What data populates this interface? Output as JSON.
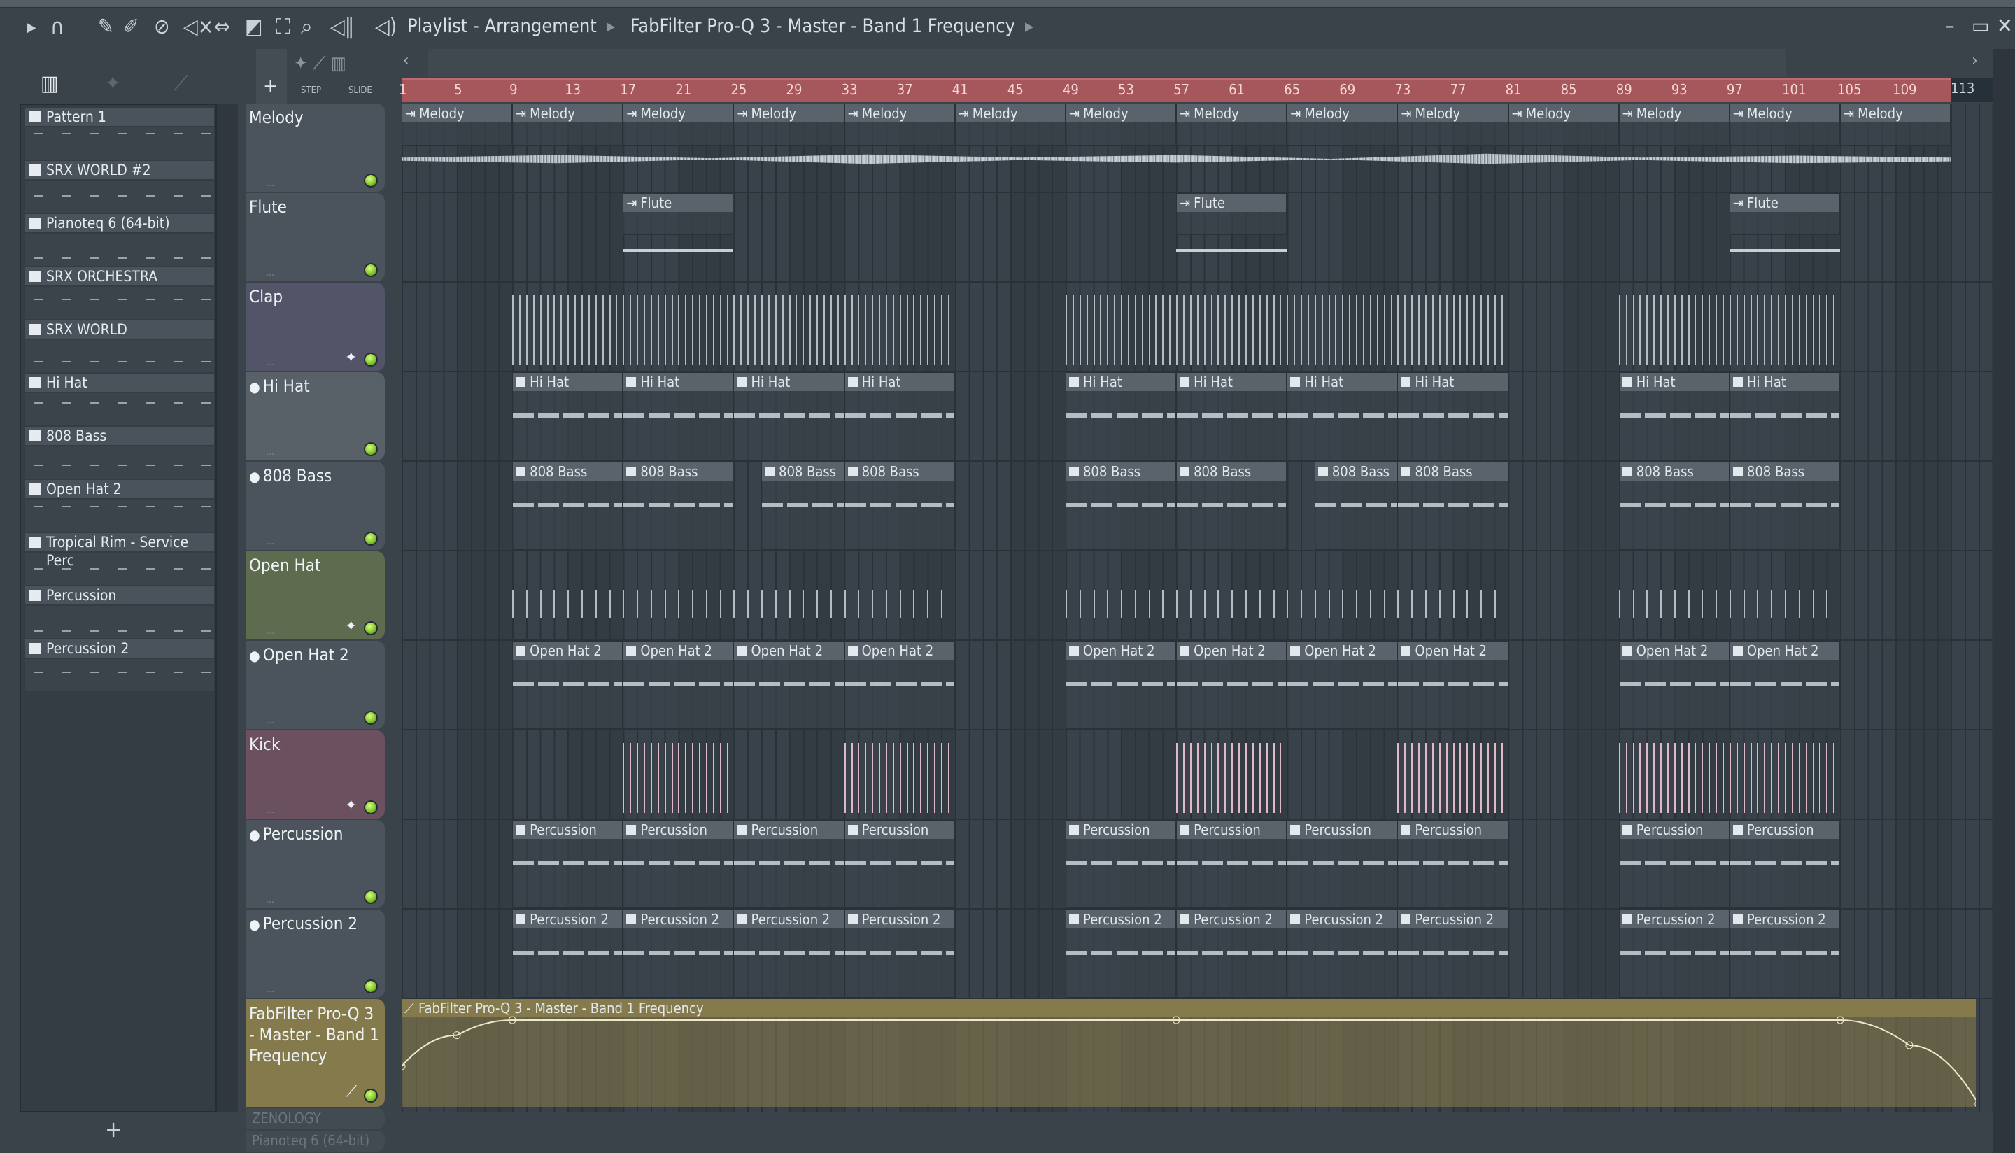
{
  "toolbar": {
    "icons": [
      "play-arrow-icon",
      "magnet-icon",
      "pencil-icon",
      "paint-icon",
      "delete-icon",
      "mute-icon",
      "slip-icon",
      "slice-icon",
      "select-icon",
      "zoom-icon",
      "playback-icon",
      "speaker-icon"
    ],
    "breadcrumb": [
      "Playlist - Arrangement",
      "FabFilter Pro-Q 3 - Master - Band 1 Frequency"
    ],
    "step_label": "STEP",
    "slide_label": "SLIDE"
  },
  "picker": {
    "items": [
      "Pattern 1",
      "SRX WORLD #2",
      "Pianoteq 6 (64-bit)",
      "SRX ORCHESTRA",
      "SRX WORLD",
      "Hi Hat",
      "808 Bass",
      "Open Hat 2",
      "Tropical Rim  - Service Perc",
      "Percussion",
      "Percussion 2"
    ]
  },
  "ruler": {
    "ticks": [
      1,
      5,
      9,
      13,
      17,
      21,
      25,
      29,
      33,
      37,
      41,
      45,
      49,
      53,
      57,
      61,
      65,
      69,
      73,
      77,
      81,
      85,
      89,
      93,
      97,
      101,
      105,
      109,
      113
    ]
  },
  "tracks": [
    {
      "name": "Melody",
      "color": "#4b535c",
      "clips": [
        [
          1,
          8
        ],
        [
          9,
          8
        ],
        [
          17,
          8
        ],
        [
          25,
          8
        ],
        [
          33,
          8
        ],
        [
          41,
          8
        ],
        [
          49,
          8
        ],
        [
          57,
          8
        ],
        [
          65,
          8
        ],
        [
          73,
          8
        ],
        [
          81,
          8
        ],
        [
          89,
          8
        ],
        [
          97,
          8
        ],
        [
          105,
          8
        ]
      ],
      "clip_label": "Melody",
      "kind": "audio-wave"
    },
    {
      "name": "Flute",
      "color": "#4b535c",
      "clips": [
        [
          17,
          8
        ],
        [
          57,
          8
        ],
        [
          97,
          8
        ]
      ],
      "clip_label": "Flute",
      "kind": "audio-wave"
    },
    {
      "name": "Clap",
      "color": "#545469",
      "audio_regions": [
        [
          9,
          41
        ],
        [
          49,
          81
        ],
        [
          89,
          105
        ]
      ],
      "kind": "ticks"
    },
    {
      "name": "Hi Hat",
      "color": "#586068",
      "clips": [
        [
          9,
          8
        ],
        [
          17,
          8
        ],
        [
          25,
          8
        ],
        [
          33,
          8
        ],
        [
          49,
          8
        ],
        [
          57,
          8
        ],
        [
          65,
          8
        ],
        [
          73,
          8
        ],
        [
          89,
          8
        ],
        [
          97,
          8
        ]
      ],
      "clip_label": "Hi Hat",
      "kind": "pattern"
    },
    {
      "name": "808 Bass",
      "color": "#4b535c",
      "clips": [
        [
          9,
          8
        ],
        [
          17,
          8
        ],
        [
          27,
          6
        ],
        [
          33,
          8
        ],
        [
          49,
          8
        ],
        [
          57,
          8
        ],
        [
          67,
          6
        ],
        [
          73,
          8
        ],
        [
          89,
          8
        ],
        [
          97,
          8
        ]
      ],
      "clip_label": "808 Bass",
      "kind": "pattern"
    },
    {
      "name": "Open Hat",
      "color": "#5f6b4e",
      "audio_regions": [
        [
          9,
          41
        ],
        [
          49,
          81
        ],
        [
          89,
          105
        ]
      ],
      "kind": "ticks"
    },
    {
      "name": "Open Hat 2",
      "color": "#4b535c",
      "clips": [
        [
          9,
          8
        ],
        [
          17,
          8
        ],
        [
          25,
          8
        ],
        [
          33,
          8
        ],
        [
          49,
          8
        ],
        [
          57,
          8
        ],
        [
          65,
          8
        ],
        [
          73,
          8
        ],
        [
          89,
          8
        ],
        [
          97,
          8
        ]
      ],
      "clip_label": "Open Hat 2",
      "kind": "pattern"
    },
    {
      "name": "Kick",
      "color": "#6b5060",
      "audio_regions": [
        [
          17,
          25
        ],
        [
          33,
          41
        ],
        [
          57,
          65
        ],
        [
          73,
          81
        ],
        [
          89,
          105
        ]
      ],
      "kind": "ticks"
    },
    {
      "name": "Percussion",
      "color": "#4b535c",
      "clips": [
        [
          9,
          8
        ],
        [
          17,
          8
        ],
        [
          25,
          8
        ],
        [
          33,
          8
        ],
        [
          49,
          8
        ],
        [
          57,
          8
        ],
        [
          65,
          8
        ],
        [
          73,
          8
        ],
        [
          89,
          8
        ],
        [
          97,
          8
        ]
      ],
      "clip_label": "Percussion",
      "kind": "pattern"
    },
    {
      "name": "Percussion 2",
      "color": "#4b535c",
      "clips": [
        [
          9,
          8
        ],
        [
          17,
          8
        ],
        [
          25,
          8
        ],
        [
          33,
          8
        ],
        [
          49,
          8
        ],
        [
          57,
          8
        ],
        [
          65,
          8
        ],
        [
          73,
          8
        ],
        [
          89,
          8
        ],
        [
          97,
          8
        ]
      ],
      "clip_label": "Percussion 2",
      "kind": "pattern"
    }
  ],
  "automation": {
    "name": "FabFilter Pro-Q 3 - Master - Band 1 Frequency",
    "clip_label": "FabFilter Pro-Q 3 - Master - Band 1 Frequency",
    "color": "#857a4b",
    "points": [
      [
        1,
        0.45
      ],
      [
        5,
        0.82
      ],
      [
        9,
        1.0
      ],
      [
        57,
        1.0
      ],
      [
        105,
        1.0
      ],
      [
        110,
        0.7
      ],
      [
        115,
        0.0
      ]
    ]
  },
  "hidden_tracks": [
    "ZENOLOGY",
    "Pianoteq 6 (64-bit)"
  ]
}
